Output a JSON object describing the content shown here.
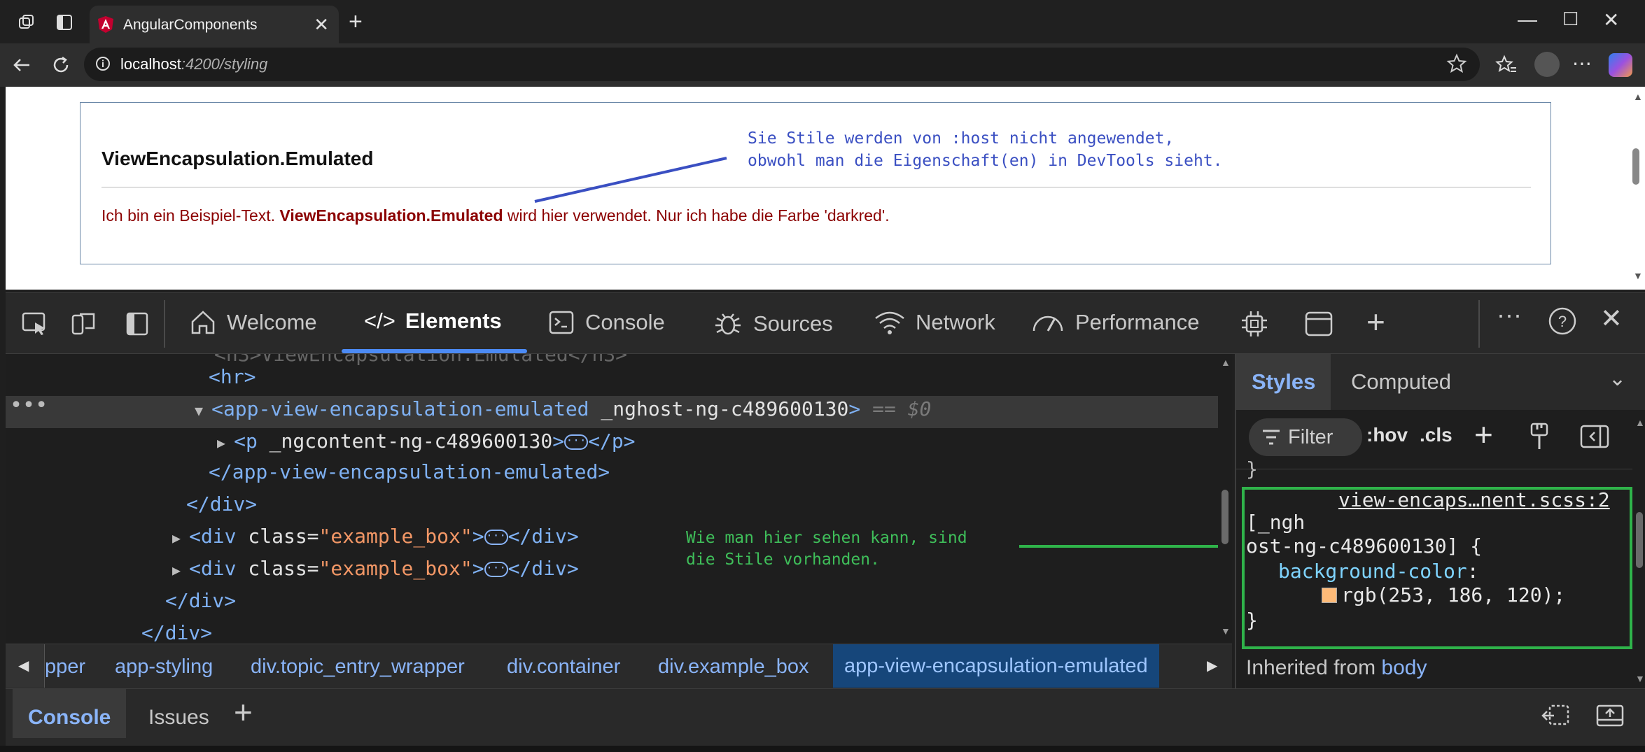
{
  "browser": {
    "tab_title": "AngularComponents",
    "url_host": "localhost",
    "url_rest": ":4200/styling"
  },
  "page": {
    "heading": "ViewEncapsulation.Emulated",
    "text_before": "Ich bin ein Beispiel-Text. ",
    "text_bold": "ViewEncapsulation.Emulated",
    "text_after": " wird hier verwendet. Nur ich habe die Farbe 'darkred'.",
    "annotation": "Sie Stile werden von :host nicht angewendet,\nobwohl man die Eigenschaft(en) in DevTools sieht."
  },
  "devtools": {
    "tabs": [
      "Welcome",
      "Elements",
      "Console",
      "Sources",
      "Network",
      "Performance"
    ],
    "elements": {
      "hr": "<hr>",
      "selected_tag": "<app-view-encapsulation-emulated",
      "selected_attr": "_nghost-ng-c489600130",
      "selected_close": ">",
      "selected_marker": "== $0",
      "p_open": "<p",
      "p_attr": "_ngcontent-ng-c489600130",
      "p_open_end": ">",
      "p_close": "</p>",
      "close_app": "</app-view-encapsulation-emulated>",
      "close_div": "</div>",
      "div_open": "<div",
      "div_class_attr": "class=",
      "div_class_val": "\"example_box\"",
      "div_gt": ">",
      "annotation": "Wie man hier sehen kann, sind\ndie Stile vorhanden."
    },
    "breadcrumbs": [
      "pper",
      "app-styling",
      "div.topic_entry_wrapper",
      "div.container",
      "div.example_box",
      "app-view-encapsulation-emulated"
    ],
    "styles_tabs": [
      "Styles",
      "Computed"
    ],
    "filter_label": "Filter",
    "hov": ":hov",
    "cls": ".cls",
    "rule": {
      "source": "view-encaps…nent.scss:2",
      "selector_line1": "[_ngh",
      "selector_line2": "ost-ng-c489600130] {",
      "property": "background-color",
      "value": "rgb(253, 186, 120);",
      "swatch": "#fdba78",
      "close": "}"
    },
    "inherited_label": "Inherited from ",
    "inherited_el": "body",
    "drawer_tabs": [
      "Console",
      "Issues"
    ]
  },
  "colors": {
    "accent": "#4c8bf5",
    "darkred": "#8b0000",
    "annotation_blue": "#3a4fc2",
    "annotation_green": "#2fb34a"
  }
}
